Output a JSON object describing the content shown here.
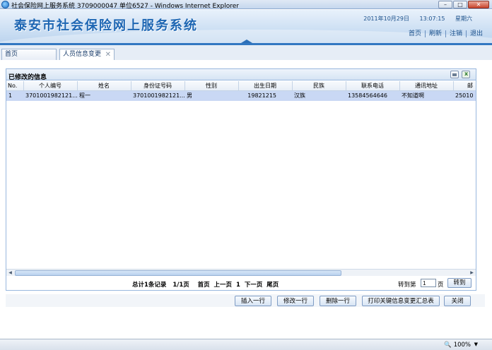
{
  "window": {
    "title": "社会保险网上服务系统 3709000047 单位6527 - Windows Internet Explorer"
  },
  "header": {
    "app_title": "泰安市社会保险网上服务系统",
    "date": "2011年10月29日",
    "time": "13:07:15",
    "weekday": "星期六",
    "links": [
      "首页",
      "刷新",
      "注销",
      "退出"
    ]
  },
  "tabs": [
    {
      "label": "首页"
    },
    {
      "label": "人员信息变更"
    }
  ],
  "grid": {
    "caption": "已修改的信息",
    "columns": [
      "No.",
      "个人编号",
      "姓名",
      "身份证号码",
      "性别",
      "出生日期",
      "民族",
      "联系电话",
      "通讯地址",
      "邮"
    ],
    "rows": [
      [
        "1",
        "3701001982121...",
        "程一",
        "3701001982121...",
        "男",
        "19821215",
        "汉族",
        "13584564646",
        "不知道啊",
        "25010"
      ]
    ]
  },
  "pager": {
    "total": "总计1条记录",
    "pages": "1/1页",
    "first": "首页",
    "prev": "上一页",
    "current": "1",
    "next": "下一页",
    "last": "尾页",
    "goto_label": "转到第",
    "goto_value": "1",
    "goto_unit": "页",
    "goto_button": "转到"
  },
  "actions": {
    "insert": "插入一行",
    "edit": "修改一行",
    "delete": "删除一行",
    "print": "打印关键信息变更汇总表",
    "close": "关闭"
  },
  "status": {
    "zoom": "100%"
  }
}
